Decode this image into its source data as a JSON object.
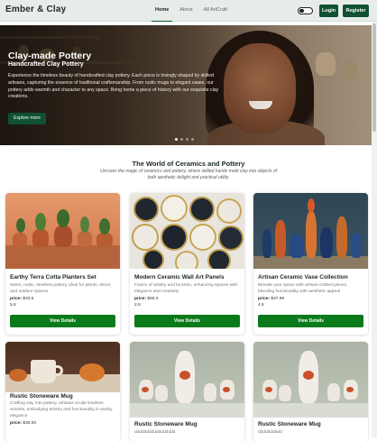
{
  "nav": {
    "brand": "Ember & Clay",
    "links": [
      "Home",
      "About",
      "All ArtCraft"
    ],
    "active_link": "Home",
    "login": "Login",
    "register": "Register"
  },
  "hero": {
    "title": "Clay-made Pottery",
    "subtitle": "Handcrafted Clay Pottery",
    "description": "Experience the timeless beauty of handcrafted clay pottery. Each piece is lovingly shaped by skilled artisans, capturing the essence of traditional craftsmanship. From rustic mugs to elegant vases, our pottery adds warmth and character to any space. Bring home a piece of history with our exquisite clay creations.",
    "button": "Explore more"
  },
  "section": {
    "title": "The World of Ceramics and Pottery",
    "subtitle": "Uncover the magic of ceramics and pottery, where skilled hands mold clay into objects of both aesthetic delight and practical utility."
  },
  "cards": [
    {
      "title": "Earthy Terra Cotta Planters Set",
      "description": "Warm, rustic, timeless pottery, ideal for plants, decor, and outdoor spaces",
      "price_label": "price:",
      "price": "$40.5",
      "rating": "5.6",
      "button": "View Details"
    },
    {
      "title": "Modern Ceramic Wall Art Panels",
      "description": "Fusion of artistry and function, enhancing spaces with elegance and creativity",
      "price_label": "price:",
      "price": "$50.3",
      "rating": "2.5",
      "button": "View Details"
    },
    {
      "title": "Artisan Ceramic Vase Collection",
      "description": "Elevate your space with artisan-crafted pieces, blending functionality with aesthetic appeal",
      "price_label": "price:",
      "price": "$37.99",
      "rating": "4.6",
      "button": "View Details"
    },
    {
      "title": "Rustic Stoneware Mug",
      "description": "Crafting clay into pottery, artisans sculpt timeless vessels, embodying artistry and functionality in earthy elegance",
      "price_label": "price:",
      "price": "$30.00"
    },
    {
      "title": "Rustic Stoneware Mug",
      "description": "ddddddddddddddddd"
    },
    {
      "title": "Rustic Stoneware Mug",
      "description": "dddddddddd"
    }
  ],
  "icons": {
    "theme_toggle": "toggle-icon"
  },
  "colors": {
    "primary": "#0f5132",
    "button_green": "#0a7a1a",
    "nav_bg": "#e7ece9"
  }
}
